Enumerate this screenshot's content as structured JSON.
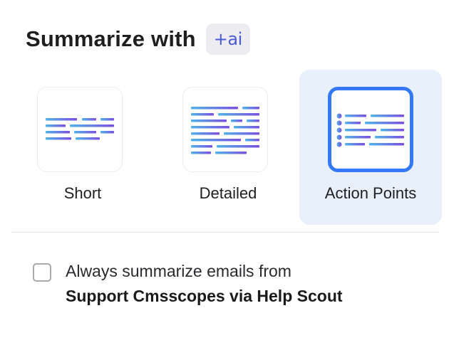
{
  "header": {
    "title": "Summarize with",
    "ai_badge": "+ai"
  },
  "options": [
    {
      "label": "Short",
      "icon": "short-summary-icon",
      "selected": false
    },
    {
      "label": "Detailed",
      "icon": "detailed-summary-icon",
      "selected": false
    },
    {
      "label": "Action Points",
      "icon": "action-points-icon",
      "selected": true
    }
  ],
  "always_summarize": {
    "checked": false,
    "prefix": "Always summarize emails from",
    "sender": "Support Cmsscopes via Help Scout"
  },
  "colors": {
    "accent": "#3478f6",
    "selected_bg": "#e7f0fb",
    "line_gradient_start": "#4fb3e8",
    "line_gradient_end": "#7b4fe0",
    "ai_badge_text": "#4b5bd6"
  }
}
